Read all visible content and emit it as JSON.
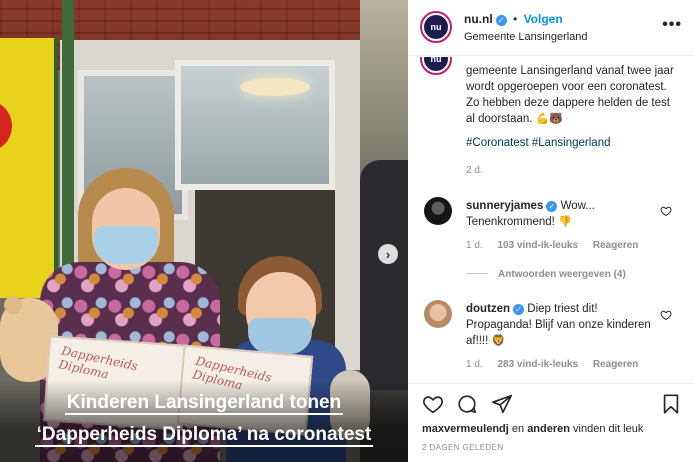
{
  "post": {
    "caption_overlay": [
      "Kinderen Lansingerland tonen",
      "‘Dapperheids Diploma’ na coronatest"
    ],
    "diploma_text": "Dapperheids Diploma",
    "next_label": "›"
  },
  "header": {
    "username": "nu.nl",
    "avatar_text": "nu",
    "verified_mark": "✓",
    "separator": "•",
    "follow_label": "Volgen",
    "location": "Gemeente Lansingerland",
    "more_label": "•••"
  },
  "caption": {
    "avatar_text": "nu",
    "text": "gemeente Lansingerland vanaf twee jaar wordt opgeroepen voor een coronatest. Zo hebben deze dappere helden de test al doorstaan.",
    "emojis": "💪🐻",
    "hashtags": "#Coronatest #Lansingerland",
    "time": "2 d."
  },
  "comments": [
    {
      "username": "sunneryjames",
      "verified_mark": "✓",
      "text": "Wow... Tenenkrommend!",
      "emoji": "👎",
      "time": "1 d.",
      "likes": "103 vind-ik-leuks",
      "reply": "Reageren"
    },
    {
      "username": "doutzen",
      "verified_mark": "✓",
      "text": "Diep triest dit! Propaganda! Blijf van onze kinderen af!!!!",
      "emoji": "🦁",
      "time": "1 d.",
      "likes": "283 vind-ik-leuks",
      "reply": "Reageren"
    }
  ],
  "replies_toggle": "Antwoorden weergeven (4)",
  "likes_line": {
    "user": "maxvermeulendj",
    "middle": " en ",
    "others": "anderen",
    "suffix": " vinden dit leuk"
  },
  "date": "2 DAGEN GELEDEN"
}
